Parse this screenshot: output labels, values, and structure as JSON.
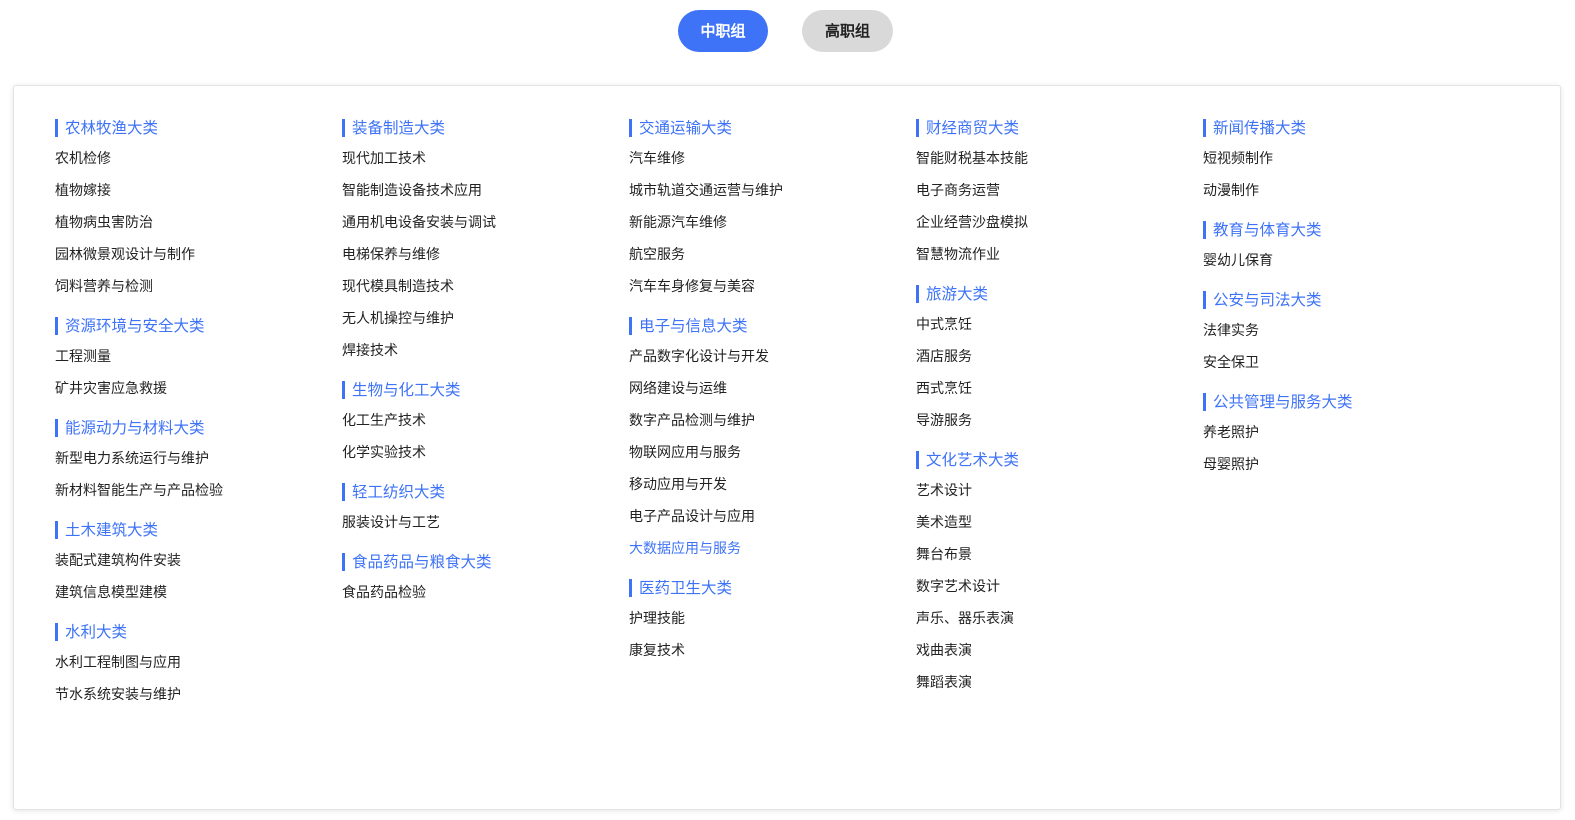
{
  "tabs": [
    {
      "label": "中职组",
      "active": true
    },
    {
      "label": "高职组",
      "active": false
    }
  ],
  "colors": {
    "accent": "#3e73f7",
    "inactive_tab": "#d9d9d9",
    "text": "#222222"
  },
  "columns": [
    {
      "categories": [
        {
          "title": "农林牧渔大类",
          "items": [
            "农机检修",
            "植物嫁接",
            "植物病虫害防治",
            "园林微景观设计与制作",
            "饲料营养与检测"
          ]
        },
        {
          "title": "资源环境与安全大类",
          "items": [
            "工程测量",
            "矿井灾害应急救援"
          ]
        },
        {
          "title": "能源动力与材料大类",
          "items": [
            "新型电力系统运行与维护",
            "新材料智能生产与产品检验"
          ]
        },
        {
          "title": "土木建筑大类",
          "items": [
            "装配式建筑构件安装",
            "建筑信息模型建模"
          ]
        },
        {
          "title": "水利大类",
          "items": [
            "水利工程制图与应用",
            "节水系统安装与维护"
          ]
        }
      ]
    },
    {
      "categories": [
        {
          "title": "装备制造大类",
          "items": [
            "现代加工技术",
            "智能制造设备技术应用",
            "通用机电设备安装与调试",
            "电梯保养与维修",
            "现代模具制造技术",
            "无人机操控与维护",
            "焊接技术"
          ]
        },
        {
          "title": "生物与化工大类",
          "items": [
            "化工生产技术",
            "化学实验技术"
          ]
        },
        {
          "title": "轻工纺织大类",
          "items": [
            "服装设计与工艺"
          ]
        },
        {
          "title": "食品药品与粮食大类",
          "items": [
            "食品药品检验"
          ]
        }
      ]
    },
    {
      "categories": [
        {
          "title": "交通运输大类",
          "items": [
            "汽车维修",
            "城市轨道交通运营与维护",
            "新能源汽车维修",
            "航空服务",
            "汽车车身修复与美容"
          ]
        },
        {
          "title": "电子与信息大类",
          "items": [
            "产品数字化设计与开发",
            "网络建设与运维",
            "数字产品检测与维护",
            "物联网应用与服务",
            "移动应用与开发",
            "电子产品设计与应用",
            "大数据应用与服务"
          ]
        },
        {
          "title": "医药卫生大类",
          "items": [
            "护理技能",
            "康复技术"
          ]
        }
      ]
    },
    {
      "categories": [
        {
          "title": "财经商贸大类",
          "items": [
            "智能财税基本技能",
            "电子商务运营",
            "企业经营沙盘模拟",
            "智慧物流作业"
          ]
        },
        {
          "title": "旅游大类",
          "items": [
            "中式烹饪",
            "酒店服务",
            "西式烹饪",
            "导游服务"
          ]
        },
        {
          "title": "文化艺术大类",
          "items": [
            "艺术设计",
            "美术造型",
            "舞台布景",
            "数字艺术设计",
            "声乐、器乐表演",
            "戏曲表演",
            "舞蹈表演"
          ]
        }
      ]
    },
    {
      "categories": [
        {
          "title": "新闻传播大类",
          "items": [
            "短视频制作",
            "动漫制作"
          ]
        },
        {
          "title": "教育与体育大类",
          "items": [
            "婴幼儿保育"
          ]
        },
        {
          "title": "公安与司法大类",
          "items": [
            "法律实务",
            "安全保卫"
          ]
        },
        {
          "title": "公共管理与服务大类",
          "items": [
            "养老照护",
            "母婴照护"
          ]
        }
      ]
    }
  ],
  "highlighted_item": "大数据应用与服务"
}
